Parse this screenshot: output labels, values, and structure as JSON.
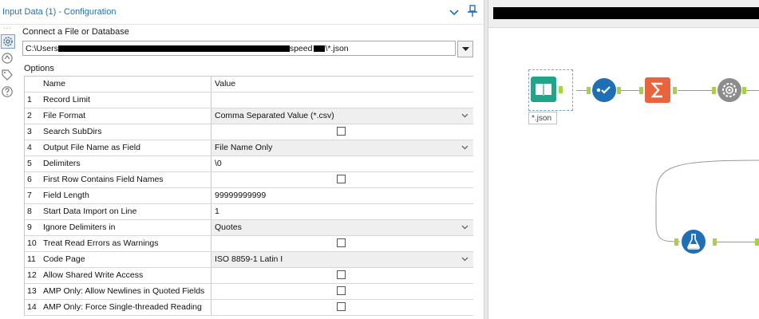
{
  "panel": {
    "title": "Input Data (1) - Configuration",
    "dots": "...",
    "connect_label": "Connect a File or Database",
    "path": {
      "prefix": "C:\\Users",
      "middle": "speed",
      "suffix": "\\*.json"
    },
    "options_label": "Options",
    "columns": {
      "name": "Name",
      "value": "Value"
    },
    "options": [
      {
        "num": "1",
        "name": "Record Limit",
        "value": "",
        "kind": "text"
      },
      {
        "num": "2",
        "name": "File Format",
        "value": "Comma Separated Value (*.csv)",
        "kind": "dropdown"
      },
      {
        "num": "3",
        "name": "Search SubDirs",
        "value": "",
        "kind": "checkbox",
        "checked": false
      },
      {
        "num": "4",
        "name": "Output File Name as Field",
        "value": "File Name Only",
        "kind": "dropdown"
      },
      {
        "num": "5",
        "name": "Delimiters",
        "value": "\\0",
        "kind": "text"
      },
      {
        "num": "6",
        "name": "First Row Contains Field Names",
        "value": "",
        "kind": "checkbox",
        "checked": false
      },
      {
        "num": "7",
        "name": "Field Length",
        "value": "99999999999",
        "kind": "text"
      },
      {
        "num": "8",
        "name": "Start Data Import on Line",
        "value": "1",
        "kind": "text"
      },
      {
        "num": "9",
        "name": "Ignore Delimiters in",
        "value": "Quotes",
        "kind": "dropdown"
      },
      {
        "num": "10",
        "name": "Treat Read Errors as Warnings",
        "value": "",
        "kind": "checkbox",
        "checked": false
      },
      {
        "num": "11",
        "name": "Code Page",
        "value": "ISO 8859-1 Latin I",
        "kind": "dropdown"
      },
      {
        "num": "12",
        "name": "Allow Shared Write Access",
        "value": "",
        "kind": "checkbox",
        "checked": false
      },
      {
        "num": "13",
        "name": "AMP Only: Allow Newlines in Quoted Fields",
        "value": "",
        "kind": "checkbox",
        "checked": false
      },
      {
        "num": "14",
        "name": "AMP Only: Force Single-threaded Reading",
        "value": "",
        "kind": "checkbox",
        "checked": false
      }
    ]
  },
  "canvas": {
    "input_tool_label": "*.json",
    "tools": [
      {
        "name": "input-data-tool",
        "icon": "book-icon",
        "color": "#1ea58a"
      },
      {
        "name": "select-tool",
        "icon": "checklist-icon",
        "color": "#1f6fb4"
      },
      {
        "name": "summarize-tool",
        "icon": "sigma-icon",
        "color": "#e8643c"
      },
      {
        "name": "json-parse-tool",
        "icon": "gear-icon",
        "color": "#8c8c8c"
      },
      {
        "name": "formula-tool",
        "icon": "flask-icon",
        "color": "#1f6fb4"
      }
    ]
  },
  "colors": {
    "accent": "#1e6fb8",
    "connector": "#a6d43e"
  }
}
